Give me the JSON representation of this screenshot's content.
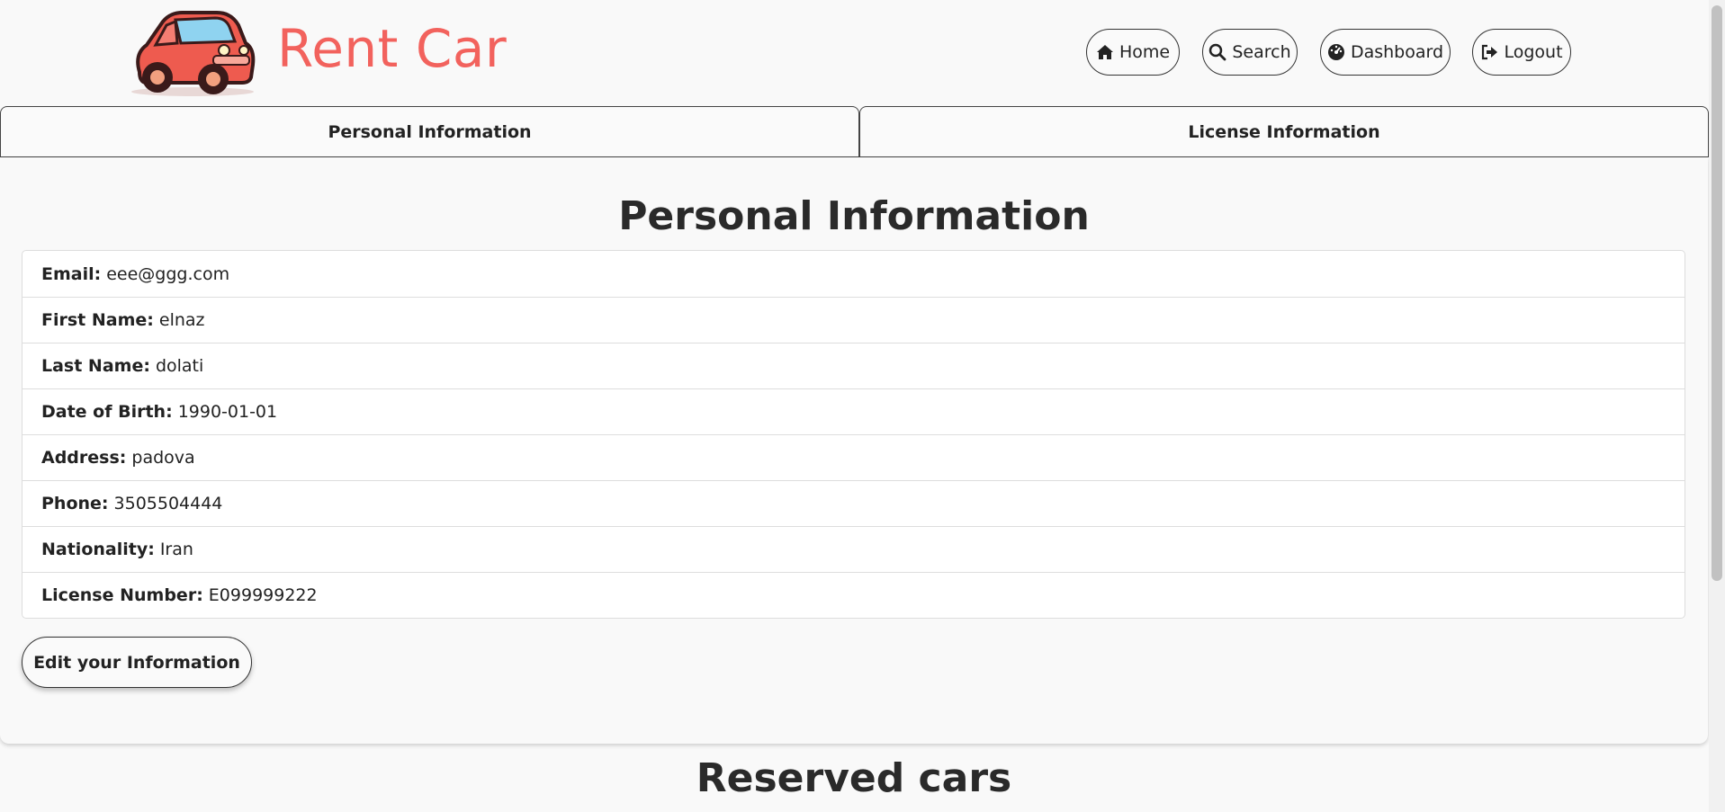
{
  "app": {
    "brand": "Rent Car",
    "brand_color": "#f2625d"
  },
  "nav": [
    {
      "label": "Home",
      "icon": "home-icon"
    },
    {
      "label": "Search",
      "icon": "search-icon"
    },
    {
      "label": "Dashboard",
      "icon": "dashboard-icon"
    },
    {
      "label": "Logout",
      "icon": "logout-icon"
    }
  ],
  "tabs": [
    {
      "label": "Personal Information"
    },
    {
      "label": "License Information"
    }
  ],
  "personal": {
    "title": "Personal Information",
    "fields": [
      {
        "label": "Email:",
        "value": "eee@ggg.com"
      },
      {
        "label": "First Name:",
        "value": "elnaz"
      },
      {
        "label": "Last Name:",
        "value": "dolati"
      },
      {
        "label": "Date of Birth:",
        "value": "1990-01-01"
      },
      {
        "label": "Address:",
        "value": "padova"
      },
      {
        "label": "Phone:",
        "value": "3505504444"
      },
      {
        "label": "Nationality:",
        "value": "Iran"
      },
      {
        "label": "License Number:",
        "value": "E099999222"
      }
    ],
    "edit_label": "Edit your Information"
  },
  "reserved": {
    "title": "Reserved cars"
  }
}
